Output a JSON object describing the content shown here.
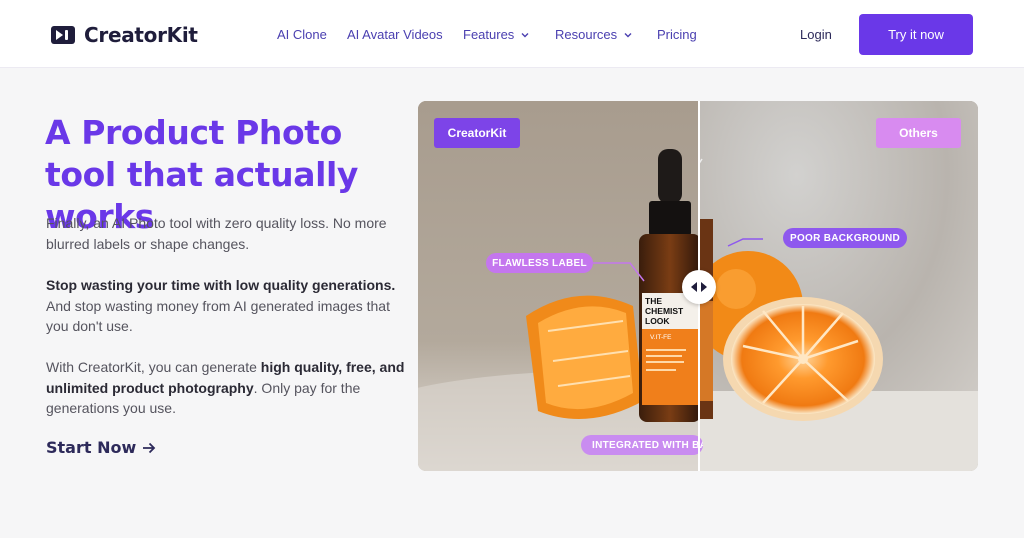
{
  "brand": {
    "name": "CreatorKit",
    "accent": "#6a38e8"
  },
  "nav": {
    "items": [
      {
        "label": "AI Clone",
        "has_dropdown": false
      },
      {
        "label": "AI Avatar Videos",
        "has_dropdown": false
      },
      {
        "label": "Features",
        "has_dropdown": true
      },
      {
        "label": "Resources",
        "has_dropdown": true
      },
      {
        "label": "Pricing",
        "has_dropdown": false
      }
    ],
    "login": "Login",
    "cta": "Try it now"
  },
  "hero": {
    "title": "A Product Photo tool that actually works",
    "p1": "Finally, an AI Photo tool with zero quality loss. No more blurred labels or shape changes.",
    "p2_bold": "Stop wasting your time with low quality generations.",
    "p2_rest": " And stop wasting money from AI generated images that you don't use.",
    "p3_a": "With CreatorKit, you can generate ",
    "p3_bold": "high quality, free, and unlimited product photography",
    "p3_b": ". Only pay for the generations you use.",
    "start_now": "Start Now"
  },
  "compare": {
    "left_tag": "CreatorKit",
    "right_tag": "Others",
    "label_flawless": "FLAWLESS LABEL",
    "label_poor": "POOR BACKGROUND",
    "label_integrated": "INTEGRATED WITH BA",
    "bottle_brand_line1": "THE",
    "bottle_brand_line2": "CHEMIST",
    "bottle_brand_line3": "LOOK",
    "bottle_product": "V.IT-FE",
    "slider_position": 0.5,
    "colors": {
      "left_tag": "#7d44e8",
      "right_tag": "#d88bf0",
      "pill_poor": "#8e58ee",
      "pill_flawless": "#c476ee"
    }
  }
}
